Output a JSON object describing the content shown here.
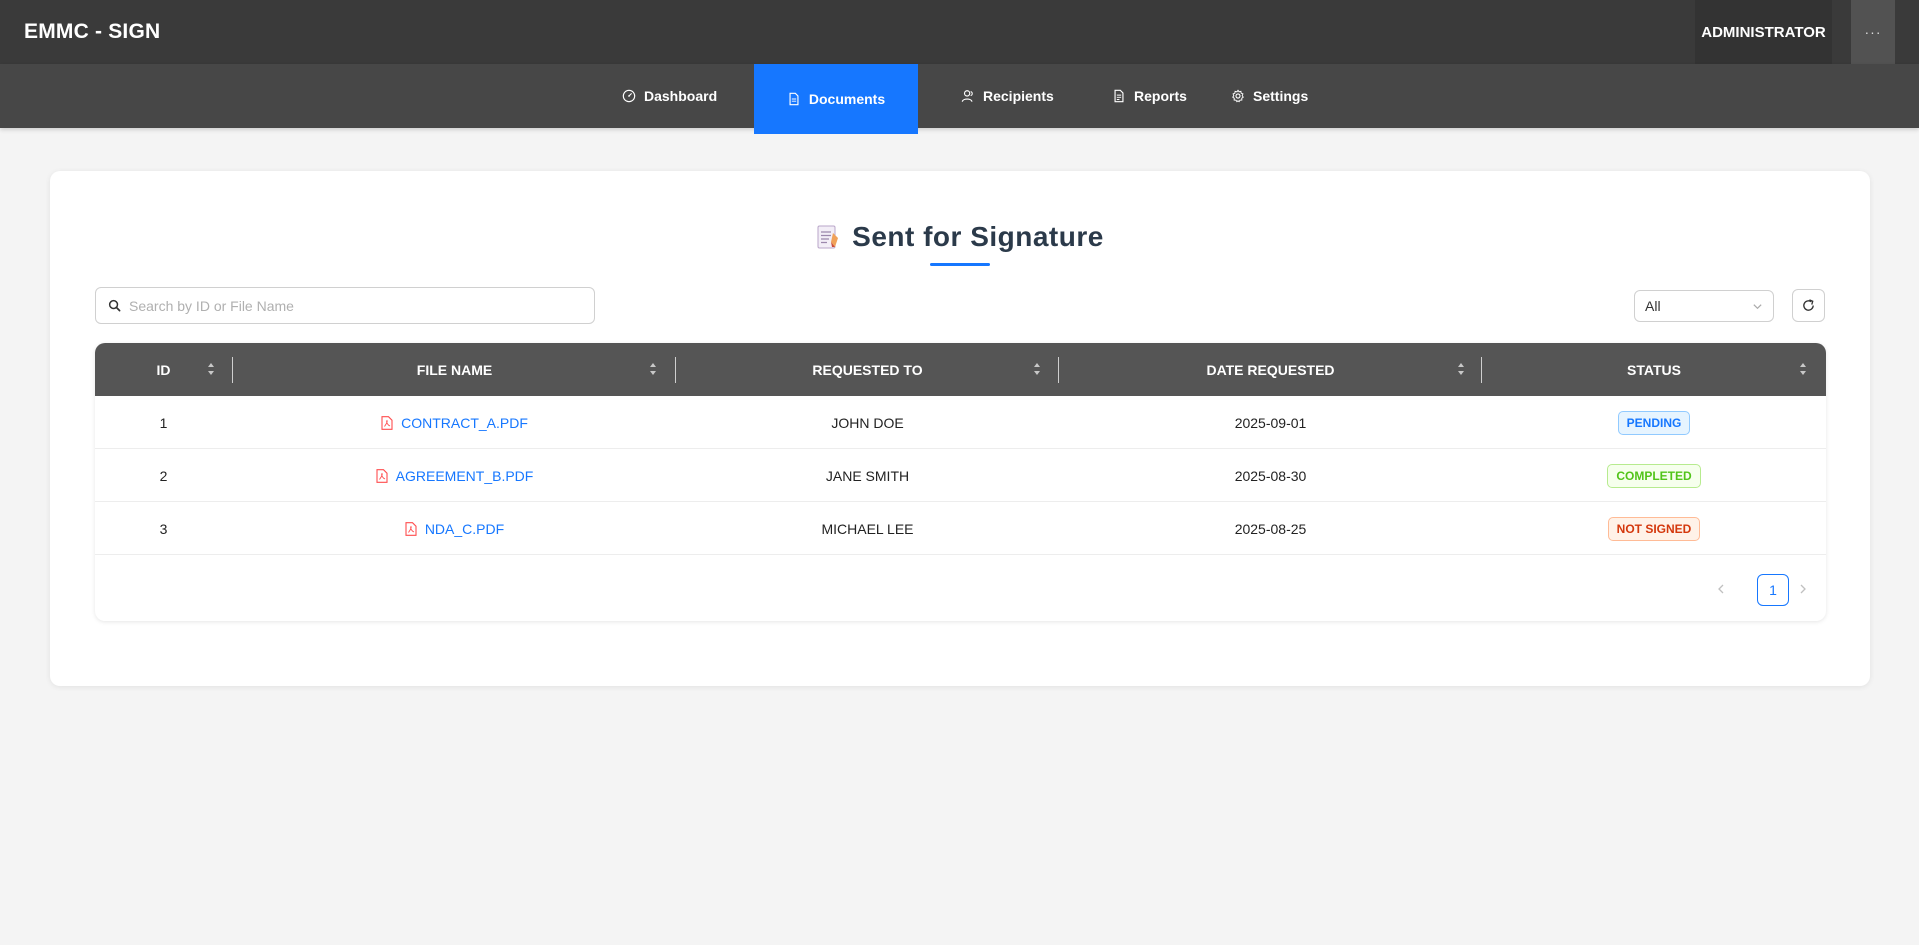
{
  "app": {
    "title": "EMMC - SIGN",
    "user": "ADMINISTRATOR",
    "more": "···"
  },
  "nav": [
    {
      "label": "Dashboard",
      "icon": "dashboard-icon"
    },
    {
      "label": "Documents",
      "icon": "document-icon",
      "active": true
    },
    {
      "label": "Recipients",
      "icon": "users-icon"
    },
    {
      "label": "Reports",
      "icon": "report-icon"
    },
    {
      "label": "Settings",
      "icon": "gear-icon"
    }
  ],
  "page": {
    "title": "Sent for Signature",
    "title_icon": "memo-icon"
  },
  "search": {
    "placeholder": "Search by ID or File Name",
    "value": ""
  },
  "filter": {
    "selected": "All"
  },
  "table": {
    "headers": [
      "ID",
      "FILE NAME",
      "REQUESTED TO",
      "DATE REQUESTED",
      "STATUS"
    ],
    "rows": [
      {
        "id": "1",
        "file": "CONTRACT_A.PDF",
        "to": "JOHN DOE",
        "date": "2025-09-01",
        "status": "PENDING"
      },
      {
        "id": "2",
        "file": "AGREEMENT_B.PDF",
        "to": "JANE SMITH",
        "date": "2025-08-30",
        "status": "COMPLETED"
      },
      {
        "id": "3",
        "file": "NDA_C.PDF",
        "to": "MICHAEL LEE",
        "date": "2025-08-25",
        "status": "NOT SIGNED"
      }
    ]
  },
  "pagination": {
    "current": "1"
  },
  "colors": {
    "accent": "#1677ff",
    "topbar": "#3a3a3a",
    "navbar": "#474747",
    "header": "#555555",
    "pdf": "#ff4d4f"
  }
}
